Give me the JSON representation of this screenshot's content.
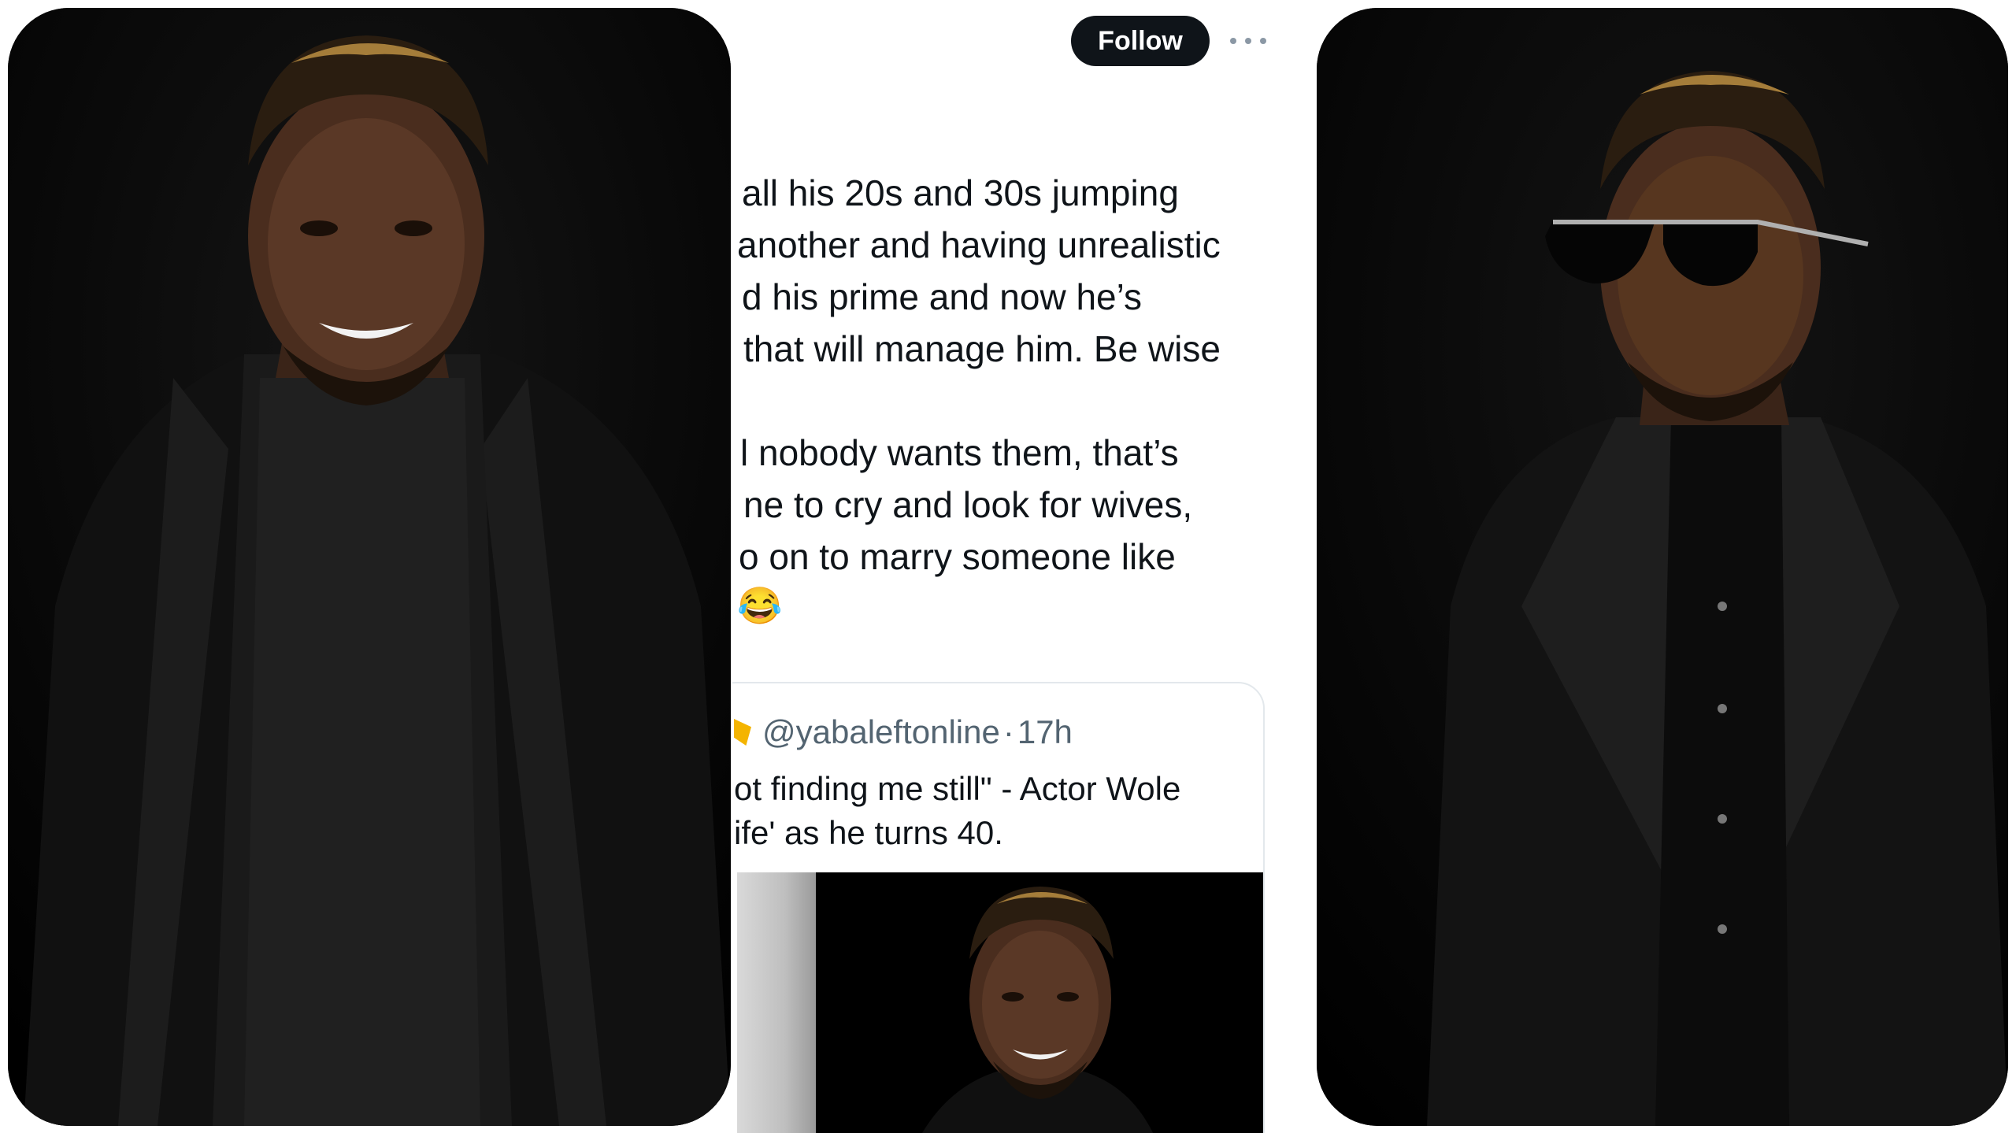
{
  "follow_label": "Follow",
  "tweet_lines": [
    "all his 20s and 30s jumping",
    "another and having unrealistic",
    "d his prime and now he’s",
    "that will manage him. Be wise",
    "",
    "l nobody wants them, that’s",
    "ne to cry and look for wives,",
    "o on to marry someone like",
    "😂"
  ],
  "quote": {
    "handle": "@yabaleftonline",
    "separator": "·",
    "time": "17h",
    "text_lines": [
      "ot finding me still\" - Actor Wole",
      "ife' as he turns 40."
    ]
  },
  "icons": {
    "more": "more-horizontal-icon",
    "badge": "verified-badge-icon"
  },
  "colors": {
    "follow_bg": "#0f1419",
    "text": "#0f1419",
    "secondary_text": "#536471",
    "photo_bg": "#050505"
  }
}
